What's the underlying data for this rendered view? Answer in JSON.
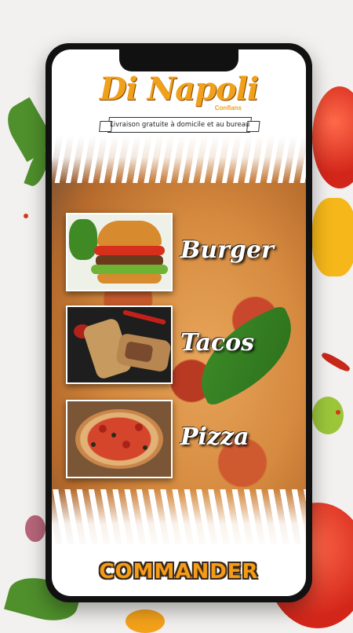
{
  "brand": {
    "name": "Di Napoli",
    "location": "Conflans",
    "tagline": "Livraison gratuite à domicile et au bureau"
  },
  "menu": {
    "items": [
      {
        "label": "Burger",
        "icon": "burger-image"
      },
      {
        "label": "Tacos",
        "icon": "tacos-image"
      },
      {
        "label": "Pizza",
        "icon": "pizza-image"
      }
    ]
  },
  "cta": {
    "label": "COMMANDER"
  },
  "colors": {
    "accent": "#f59b16",
    "outline": "#3a2a1a",
    "phone": "#111111"
  }
}
